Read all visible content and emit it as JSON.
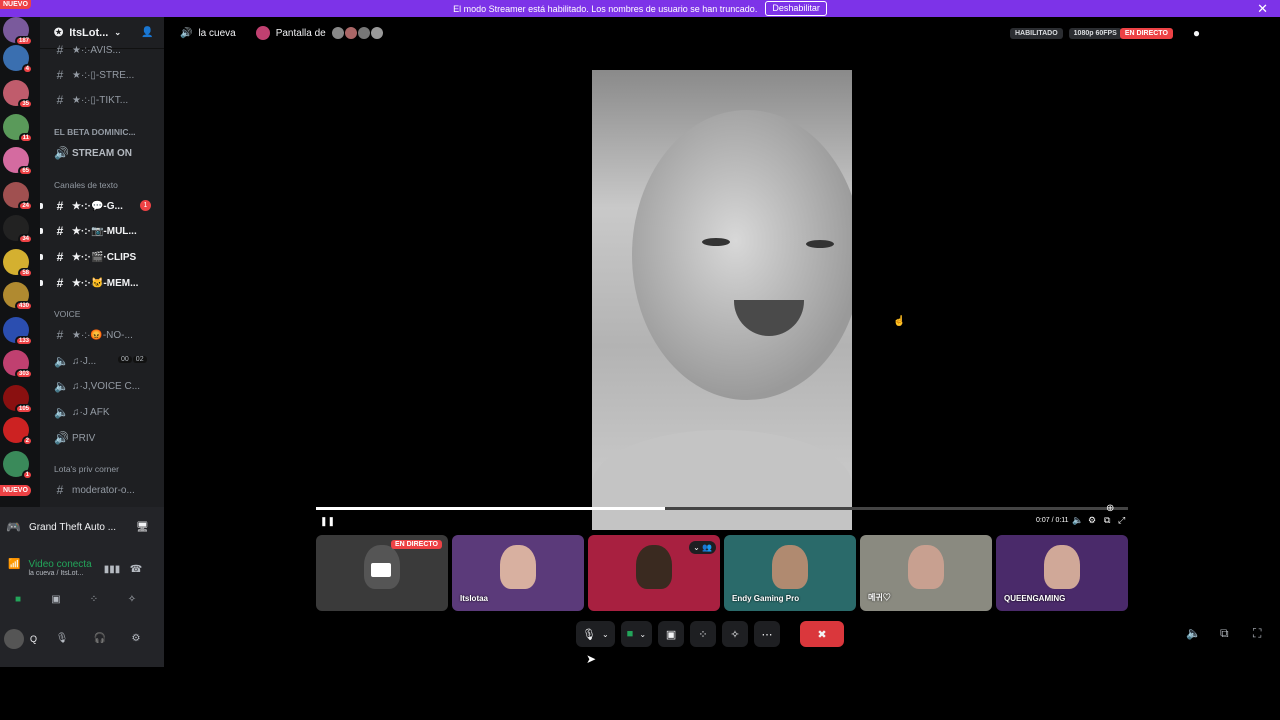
{
  "banner": {
    "text": "El modo Streamer está habilitado. Los nombres de usuario se han truncado.",
    "button": "Deshabilitar",
    "close": "✕",
    "nuevo": "NUEVO"
  },
  "guilds": [
    {
      "badge": "187",
      "color": "#7a5a9c"
    },
    {
      "badge": "4",
      "color": "#3a6fb0"
    },
    {
      "badge": "35",
      "color": "#c05c6c"
    },
    {
      "badge": "11",
      "color": "#5a9a5a"
    },
    {
      "badge": "65",
      "color": "#d46ba0"
    },
    {
      "badge": "24",
      "color": "#a05050"
    },
    {
      "badge": "34",
      "color": "#222222"
    },
    {
      "badge": "58",
      "color": "#d4b030"
    },
    {
      "badge": "430",
      "color": "#b08a30"
    },
    {
      "badge": "133",
      "color": "#2b4eb0"
    },
    {
      "badge": "303",
      "color": "#c04070"
    },
    {
      "badge": "105",
      "color": "#8a1010"
    },
    {
      "badge": "2",
      "color": "#cc2222"
    },
    {
      "badge": "1",
      "color": "#3a8a5a"
    }
  ],
  "guild_bottom_badge": "NUEVO",
  "server": {
    "name": "ItsLot...",
    "items": [
      {
        "type": "chan",
        "label": "★·:·AVIS...",
        "top": 0
      },
      {
        "type": "chan",
        "label": "★·:·▯-STRE...",
        "icon": "#"
      },
      {
        "type": "chan",
        "label": "★·:·▯-TIKT...",
        "icon": "#"
      }
    ]
  },
  "channels": {
    "c1": "★·:·AVIS...",
    "c2": "★·:·▯-STRE...",
    "c3": "★·:·▯-TIKT...",
    "cat_beta": "EL BETA DOMINIC...",
    "stream_on": "STREAM ON",
    "cat_text": "Canales de texto",
    "t1": "★·:·💬-G...",
    "t1_count": "1",
    "t2": "★·:·📷-MUL...",
    "t3": "★·:·🎬·CLIPS",
    "t4": "★·:·🐱-MEM...",
    "cat_voice": "VOICE",
    "v1": "★·:·😡-NO-...",
    "v2": "♫·J...",
    "v2_a": "00",
    "v2_b": "02",
    "v3": "♫·J,VOICE C...",
    "v4": "♫·J AFK",
    "v5": "PRIV",
    "cat_priv": "Lota's priv corner",
    "p1": "moderator-o..."
  },
  "panel": {
    "activity": "Grand Theft Auto ...",
    "voice_status": "Video conecta",
    "voice_sub": "la cueva / ItsLot...",
    "user": "Q"
  },
  "topbar": {
    "channel": "la cueva",
    "screen": "Pantalla de",
    "habilitado": "HABILITADO",
    "quality": "1080p 60FPS",
    "live": "EN DIRECTO"
  },
  "video": {
    "progress": 0.43,
    "time": "0:07 / 0:11"
  },
  "tiles": [
    {
      "name": "",
      "live": "EN DIRECTO",
      "bg": "#3a3a3a",
      "person": "#555555"
    },
    {
      "name": "Itslotaa",
      "live": "",
      "bg": "#5b3a7a",
      "person": "#d8b0a0"
    },
    {
      "name": "",
      "live": "",
      "bg": "#a82040",
      "person": "#3a2a20"
    },
    {
      "name": "Endy Gaming Pro",
      "live": "",
      "bg": "#2a6a6a",
      "person": "#b08a70"
    },
    {
      "name": "메귀♡",
      "live": "",
      "bg": "#8a8a80",
      "person": "#c8a090"
    },
    {
      "name": "QUEENGAMING",
      "live": "",
      "bg": "#4a2a6a",
      "person": "#d0a898"
    }
  ]
}
